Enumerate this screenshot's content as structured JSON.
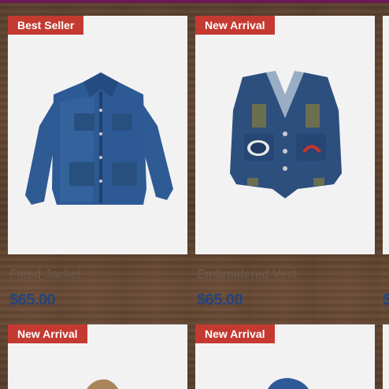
{
  "products": [
    {
      "badge": "Best Seller",
      "name": "Fitted Jacket",
      "price": "$65.00",
      "icon": "denim-jacket-image"
    },
    {
      "badge": "New Arrival",
      "name": "Embroidered Vest",
      "price": "$65.00",
      "icon": "denim-vest-image"
    },
    {
      "badge": "New Arrival",
      "name": "",
      "price": "",
      "icon": "product-image"
    },
    {
      "badge": "New Arrival",
      "name": "",
      "price": "",
      "icon": "product-image"
    }
  ],
  "third_column_price_fragment": "$",
  "colors": {
    "badge": "#c43a31",
    "price": "#24447e",
    "top_bar": "#6a1a57"
  }
}
